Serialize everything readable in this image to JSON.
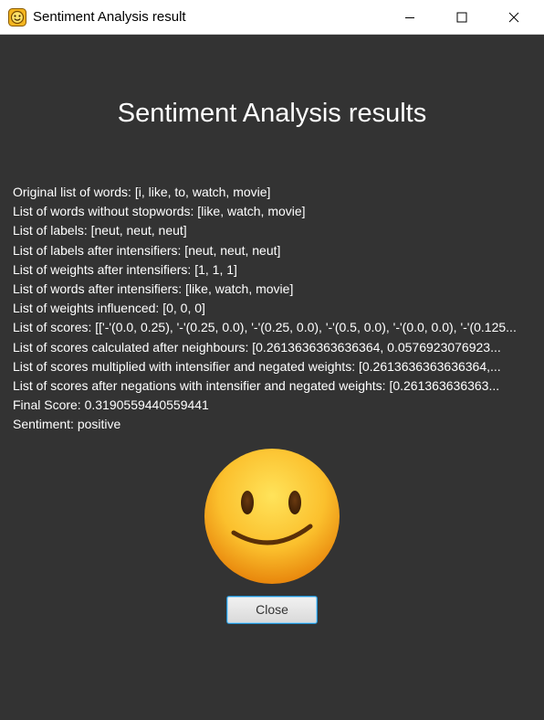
{
  "window": {
    "title": "Sentiment Analysis result"
  },
  "main": {
    "heading": "Sentiment Analysis results",
    "lines": [
      "Original list of words: [i, like, to, watch, movie]",
      "List of words without stopwords: [like, watch, movie]",
      "List of labels: [neut, neut, neut]",
      "List of labels after intensifiers: [neut, neut, neut]",
      "List of weights after intensifiers: [1, 1, 1]",
      "List of words after intensifiers: [like, watch, movie]",
      "List of weights influenced: [0, 0, 0]",
      "List of scores: [['-'(0.0, 0.25), '-'(0.25, 0.0), '-'(0.25, 0.0), '-'(0.5, 0.0), '-'(0.0, 0.0), '-'(0.125...",
      "List of scores calculated after neighbours: [0.2613636363636364, 0.0576923076923...",
      "List of scores multiplied with intensifier and negated weights: [0.2613636363636364,...",
      "List of scores after negations with intensifier and negated weights: [0.261363636363...",
      "Final Score: 0.3190559440559441",
      "Sentiment: positive"
    ],
    "close_label": "Close"
  },
  "colors": {
    "background": "#333333",
    "titlebar": "#ffffff",
    "button_border": "#1e8fd0"
  },
  "icons": {
    "app": "smiley-app-icon",
    "result": "slightly-smiling-face-emoji"
  }
}
